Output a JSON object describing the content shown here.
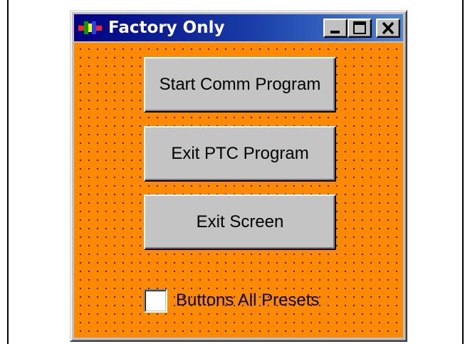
{
  "window": {
    "title": "Factory Only",
    "icon": "app-icon",
    "controls": [
      "minimize-icon",
      "maximize-icon",
      "close-icon"
    ]
  },
  "buttons": {
    "start_comm": "Start Comm Program",
    "exit_ptc": "Exit PTC Program",
    "exit_screen": "Exit Screen"
  },
  "checkbox": {
    "label": "Buttons All Presets",
    "checked": false
  },
  "colors": {
    "client_background": "#ff8a00",
    "titlebar": "#000080",
    "button_face": "#c0c0c0"
  }
}
